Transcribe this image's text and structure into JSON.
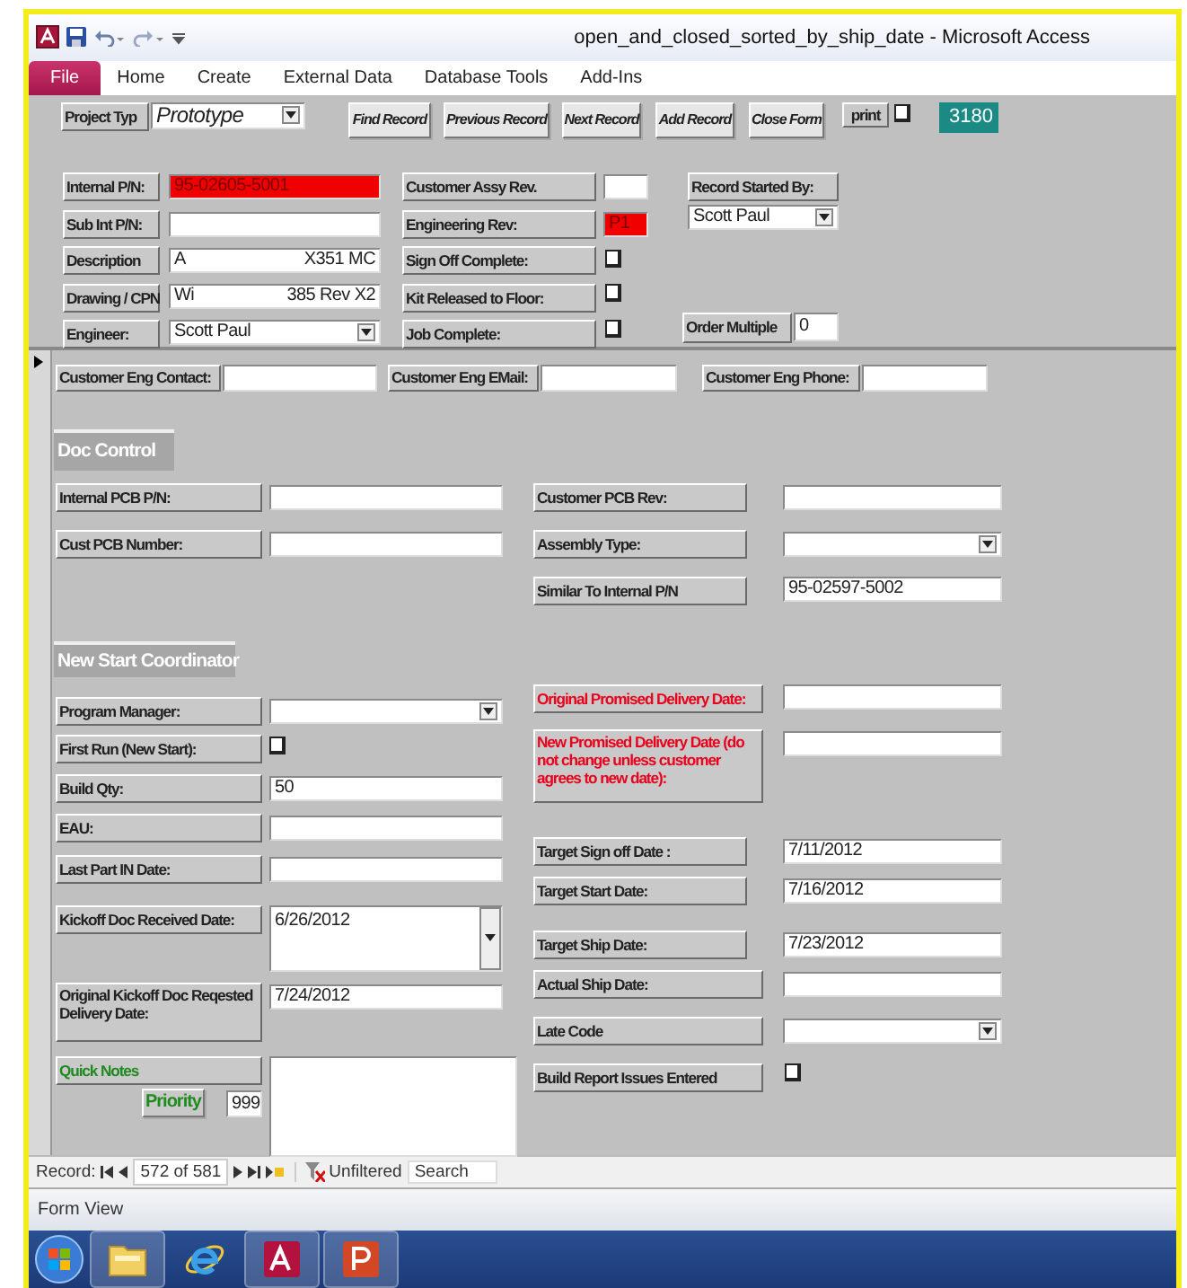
{
  "window": {
    "title": "open_and_closed_sorted_by_ship_date - Microsoft Access"
  },
  "ribbon": {
    "file_tab": "File",
    "tabs": [
      "Home",
      "Create",
      "External Data",
      "Database Tools",
      "Add-Ins"
    ]
  },
  "form_header": {
    "project_type": {
      "label": "Project Typ",
      "value": "Prototype"
    },
    "buttons": [
      "Find Record",
      "Previous Record",
      "Next Record",
      "Add Record",
      "Close Form"
    ],
    "print": {
      "label": "print",
      "checked": false
    },
    "record_id": "3180",
    "fields": [
      {
        "kind": "text",
        "label": "Internal P/N:",
        "value": "95-02605-5001",
        "flagged": true
      },
      {
        "kind": "text",
        "label": "Sub Int P/N:",
        "flagged": false
      },
      {
        "kind": "split",
        "label": "Description",
        "values": [
          "A",
          "X351 MC"
        ],
        "flagged": false
      },
      {
        "kind": "split",
        "label": "Drawing / CPN",
        "values": [
          "Wi",
          "385 Rev X2"
        ],
        "flagged": false
      },
      {
        "kind": "combo",
        "label": "Engineer:",
        "value": "Scott Paul",
        "flagged": false
      },
      {
        "kind": "text",
        "label": "Customer Assy Rev.",
        "flagged": false
      },
      {
        "kind": "text",
        "label": "Engineering Rev:",
        "value": "P1",
        "flagged": true
      },
      {
        "kind": "check",
        "label": "Sign Off Complete:",
        "checked": false
      },
      {
        "kind": "check",
        "label": "Kit Released to Floor:",
        "checked": false
      },
      {
        "kind": "check",
        "label": "Job Complete:",
        "checked": false
      },
      {
        "kind": "combo",
        "label": "Record Started By:",
        "value": "Scott Paul",
        "flagged": false
      },
      {
        "kind": "text",
        "label": "Order Multiple",
        "value": "0",
        "flagged": false
      }
    ]
  },
  "detail": {
    "contact_fields": [
      {
        "kind": "text",
        "label": "Customer Eng Contact:"
      },
      {
        "kind": "text",
        "label": "Customer Eng EMail:"
      },
      {
        "kind": "text",
        "label": "Customer Eng Phone:"
      }
    ],
    "doc_control": {
      "heading": "Doc Control",
      "fields": [
        {
          "kind": "text",
          "label": "Internal PCB P/N:"
        },
        {
          "kind": "text",
          "label": "Cust PCB Number:"
        },
        {
          "kind": "text",
          "label": "Customer PCB Rev:"
        },
        {
          "kind": "combo",
          "label": "Assembly Type:"
        },
        {
          "kind": "text",
          "label": "Similar To Internal P/N",
          "value": "95-02597-5002"
        }
      ]
    },
    "new_start": {
      "heading": "New Start Coordinator",
      "fields": [
        {
          "kind": "combo",
          "label": "Program Manager:"
        },
        {
          "kind": "check",
          "label": "First Run (New Start):",
          "checked": false
        },
        {
          "kind": "text",
          "label": "Build Qty:",
          "value": "50"
        },
        {
          "kind": "text",
          "label": "EAU:"
        },
        {
          "kind": "text",
          "label": "Last Part IN Date:"
        },
        {
          "kind": "memo-combo",
          "label": "Kickoff Doc Received Date:",
          "value": "6/26/2012"
        },
        {
          "kind": "text",
          "label": "Original Kickoff Doc Reqested Delivery Date:",
          "value": "7/24/2012"
        },
        {
          "kind": "text",
          "label": "Original Promised Delivery Date:",
          "color": "#e8001c"
        },
        {
          "kind": "text",
          "label": "New Promised Delivery Date (do not change unless customer agrees to new date):",
          "color": "#e8001c"
        },
        {
          "kind": "text",
          "label": "Target Sign off Date :",
          "value": "7/11/2012"
        },
        {
          "kind": "text",
          "label": "Target Start Date:",
          "value": "7/16/2012"
        },
        {
          "kind": "text",
          "label": "Target Ship Date:",
          "value": "7/23/2012"
        },
        {
          "kind": "text",
          "label": "Actual Ship Date:"
        },
        {
          "kind": "combo",
          "label": "Late Code"
        },
        {
          "kind": "check",
          "label": "Build Report Issues Entered",
          "checked": false
        }
      ]
    },
    "quick_notes": {
      "label": "Quick Notes",
      "priority_button": "Priority",
      "priority": "999"
    }
  },
  "record_nav": {
    "label": "Record:",
    "position": "572 of 581",
    "filter": "Unfiltered",
    "search_placeholder": "Search"
  },
  "status_bar": {
    "text": "Form View"
  }
}
